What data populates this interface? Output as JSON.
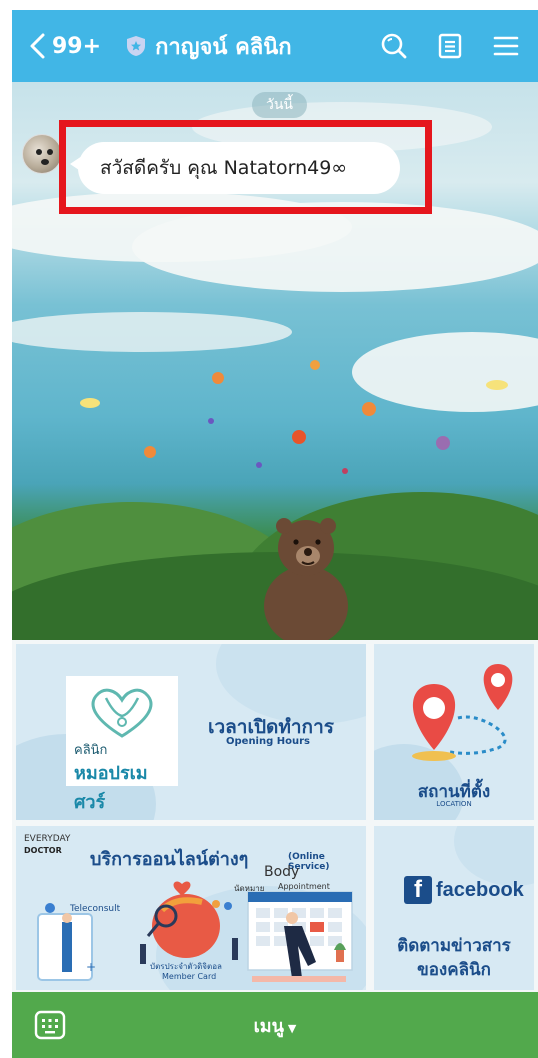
{
  "header": {
    "back_count": "99+",
    "title": "กาญจน์ คลินิก",
    "color": "#41b6e6"
  },
  "chat": {
    "date_label": "วันนี้",
    "message": "สวัสดีครับ คุณ Natatorn49∞",
    "highlight_color": "#e5161d"
  },
  "rich_menu": {
    "opening_hours": {
      "logo_sub": "คลินิก",
      "logo_main": "หมอปรเมศวร์",
      "label_th": "เวลาเปิดทำการ",
      "label_en": "Opening Hours"
    },
    "location": {
      "label_th": "สถานที่ตั้ง",
      "label_en": "LOCATION"
    },
    "online_service": {
      "everyday": "EVERYDAY",
      "doctor": "DOCTOR",
      "label_th": "บริการออนไลน์ต่างๆ",
      "label_en": "(Online Service)",
      "body": "Body",
      "appointment_th": "นัดหมาย",
      "appointment_en": "Appointment",
      "teleconsult": "Teleconsult",
      "member_card_th": "บัตรประจำตัวดิจิตอล",
      "member_card_en": "Member Card"
    },
    "facebook": {
      "brand": "facebook",
      "line1": "ติดตามข่าวสาร",
      "line2": "ของคลินิก"
    }
  },
  "bottom_bar": {
    "menu_label": "เมนู",
    "color": "#52a94c"
  }
}
